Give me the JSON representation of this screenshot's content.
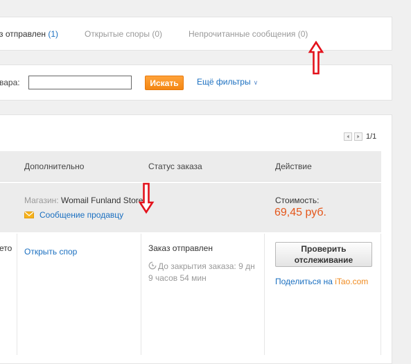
{
  "tabs": [
    {
      "label": "з отправлен",
      "count": "(1)",
      "active": true
    },
    {
      "label": "Открытые споры",
      "count": "(0)",
      "active": false
    },
    {
      "label": "Непрочитанные сообщения",
      "count": "(0)",
      "active": false
    }
  ],
  "search": {
    "label": "вара:",
    "input_value": "",
    "button_label": "Искать",
    "filters_label": "Ещё фильтры"
  },
  "pager": {
    "text": "1/1"
  },
  "table": {
    "headers": [
      "Дополнительно",
      "Статус заказа",
      "Действие"
    ]
  },
  "store_row": {
    "store_label": "Магазин:",
    "store_name": "Womail Funland Store",
    "message_link": "Сообщение продавцу",
    "cost_label": "Стоимость:",
    "cost_value": "69,45 руб."
  },
  "order_row": {
    "left_truncated": "ето",
    "dispute_link": "Открыть спор",
    "status": "Заказ отправлен",
    "countdown": "До закрытия заказа: 9 дн 9 часов 54 мин",
    "track_button": "Проверить отслеживание",
    "share_prefix": "Поделиться на",
    "share_brand": "iTao.com"
  },
  "colors": {
    "accent_link": "#1a6fc0",
    "search_button": "#f38613",
    "price": "#e4561a",
    "annotation_arrow": "#e3121c"
  },
  "icons": [
    "envelope-icon",
    "clock-icon",
    "prev-page-icon",
    "next-page-icon",
    "chevron-down-icon"
  ]
}
